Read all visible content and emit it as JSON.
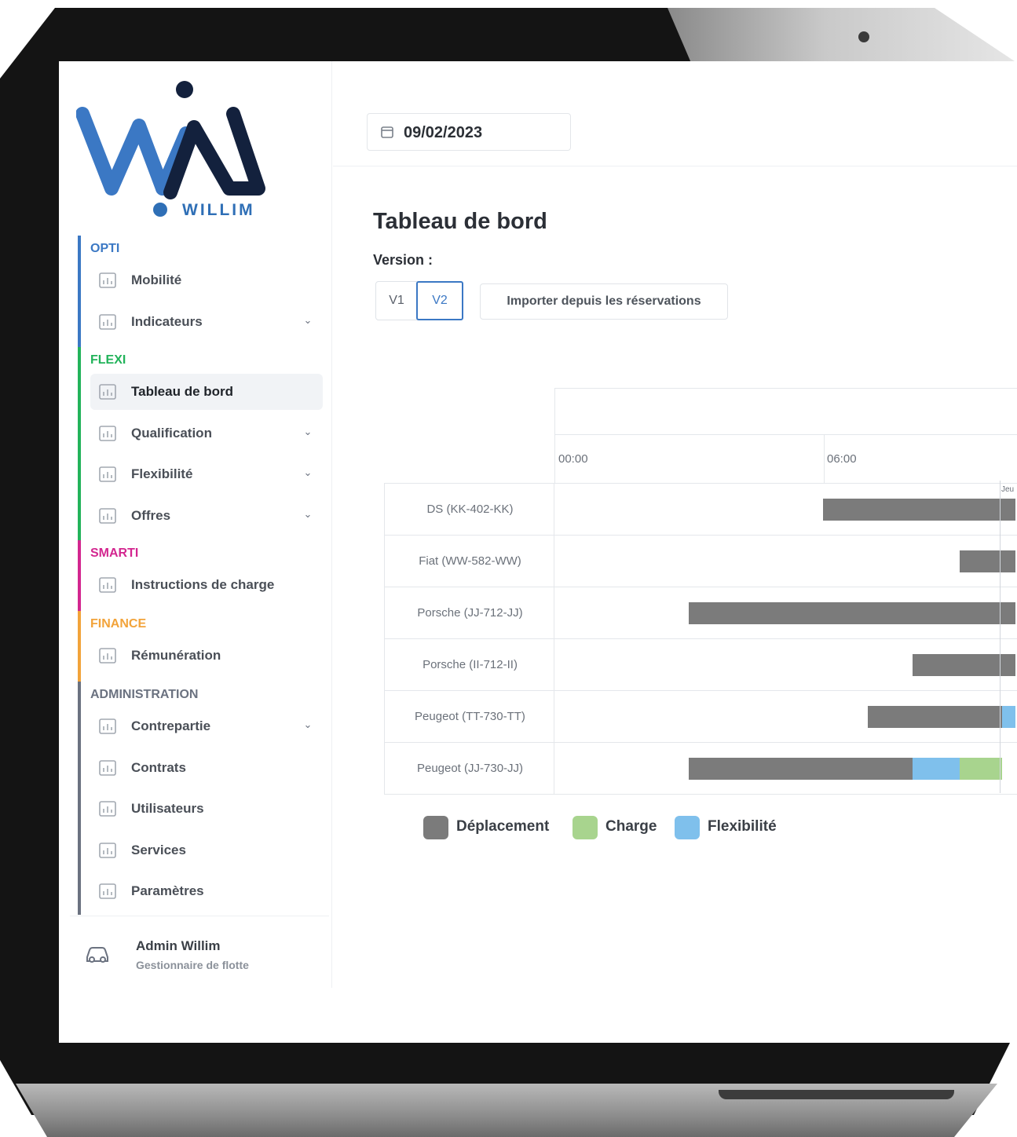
{
  "brand": {
    "name": "WILLIM"
  },
  "sections": [
    {
      "title": "OPTI",
      "color": "#3b78c4",
      "items": [
        {
          "label": "Mobilité",
          "icon": "calendar-car-icon",
          "chevron": false,
          "active": false
        },
        {
          "label": "Indicateurs",
          "icon": "bar-chart-icon",
          "chevron": true,
          "active": false
        }
      ]
    },
    {
      "title": "FLEXI",
      "color": "#22b35a",
      "items": [
        {
          "label": "Tableau de bord",
          "icon": "line-chart-icon",
          "chevron": false,
          "active": true
        },
        {
          "label": "Qualification",
          "icon": "bar-chart-icon",
          "chevron": true,
          "active": false
        },
        {
          "label": "Flexibilité",
          "icon": "bar-chart-icon",
          "chevron": true,
          "active": false
        },
        {
          "label": "Offres",
          "icon": "grid-icon",
          "chevron": true,
          "active": false
        }
      ]
    },
    {
      "title": "SMARTI",
      "color": "#d3268f",
      "items": [
        {
          "label": "Instructions de charge",
          "icon": "charge-icon",
          "chevron": false,
          "active": false
        }
      ]
    },
    {
      "title": "FINANCE",
      "color": "#f2a33a",
      "items": [
        {
          "label": "Rémunération",
          "icon": "coins-icon",
          "chevron": false,
          "active": false
        }
      ]
    },
    {
      "title": "ADMINISTRATION",
      "color": "#6b7280",
      "items": [
        {
          "label": "Contrepartie",
          "icon": "building-icon",
          "chevron": true,
          "active": false
        },
        {
          "label": "Contrats",
          "icon": "document-icon",
          "chevron": false,
          "active": false
        },
        {
          "label": "Utilisateurs",
          "icon": "users-icon",
          "chevron": false,
          "active": false
        },
        {
          "label": "Services",
          "icon": "sitemap-icon",
          "chevron": false,
          "active": false
        },
        {
          "label": "Paramètres",
          "icon": "sliders-icon",
          "chevron": false,
          "active": false
        }
      ]
    }
  ],
  "user": {
    "name": "Admin Willim",
    "role": "Gestionnaire de flotte"
  },
  "topbar": {
    "date": "09/02/2023"
  },
  "page": {
    "title": "Tableau de bord",
    "version_label": "Version :",
    "versions": [
      "V1",
      "V2"
    ],
    "selected_version": "V2",
    "import_button": "Importer depuis les réservations"
  },
  "chart_data": {
    "type": "gantt",
    "x_ticks": [
      "00:00",
      "06:00"
    ],
    "now_marker_label": "Jeu",
    "categories": [
      "DS (KK-402-KK)",
      "Fiat (WW-582-WW)",
      "Porsche (JJ-712-JJ)",
      "Porsche (II-712-II)",
      "Peugeot (TT-730-TT)",
      "Peugeot (JJ-730-JJ)"
    ],
    "series": [
      {
        "name": "Déplacement",
        "color": "#7b7b7b",
        "segments": [
          {
            "row": 0,
            "start": 6.0,
            "end": 10.3
          },
          {
            "row": 1,
            "start": 9.05,
            "end": 10.3
          },
          {
            "row": 2,
            "start": 3.0,
            "end": 10.3
          },
          {
            "row": 3,
            "start": 8.0,
            "end": 10.3
          },
          {
            "row": 4,
            "start": 7.0,
            "end": 10.0
          },
          {
            "row": 5,
            "start": 3.0,
            "end": 8.0
          }
        ]
      },
      {
        "name": "Charge",
        "color": "#a8d48e",
        "segments": [
          {
            "row": 5,
            "start": 9.05,
            "end": 10.0
          }
        ]
      },
      {
        "name": "Flexibilité",
        "color": "#7fc0ec",
        "segments": [
          {
            "row": 4,
            "start": 10.0,
            "end": 10.3
          },
          {
            "row": 5,
            "start": 8.0,
            "end": 9.05
          }
        ]
      }
    ]
  }
}
